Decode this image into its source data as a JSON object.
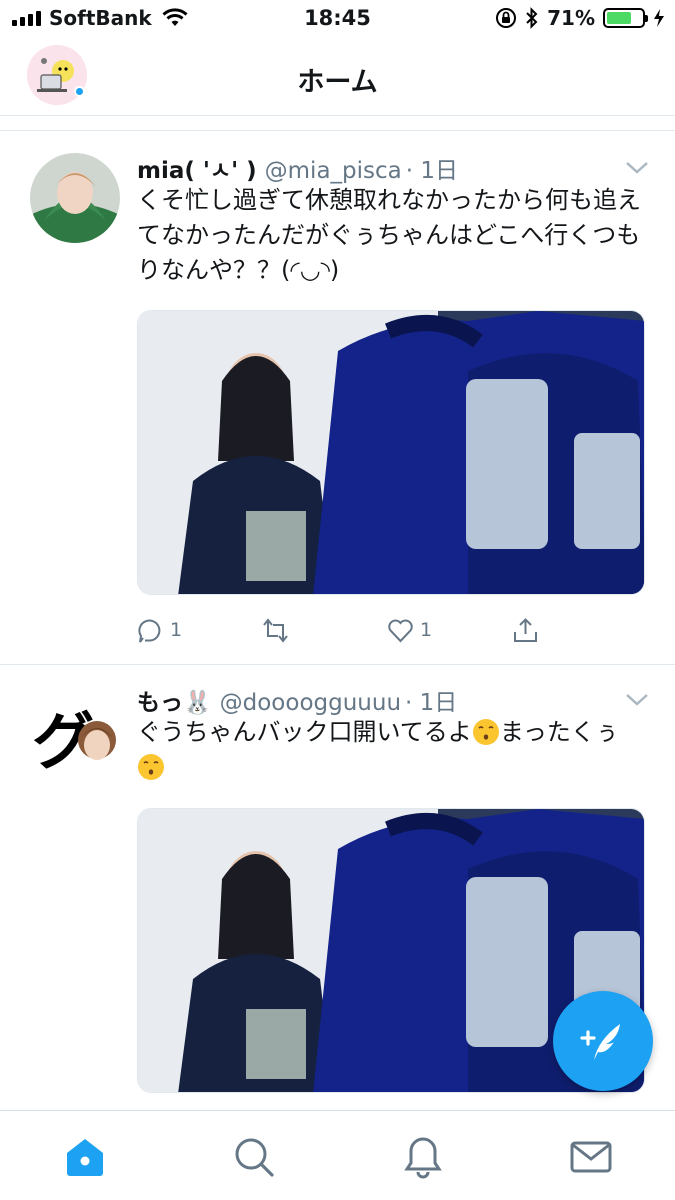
{
  "status_bar": {
    "carrier": "SoftBank",
    "time": "18:45",
    "battery_percent": "71%",
    "battery_level": 0.71
  },
  "header": {
    "title": "ホーム"
  },
  "tweets": [
    {
      "name": "mia( 'ㅅ' )",
      "handle": "@mia_pisca",
      "time": "· 1日",
      "text": "くそ忙し過ぎて休憩取れなかったから何も追えてなかったんだがぐぅちゃんはどこへ行くつもりなんや？？(◜◡◝)",
      "replies": "1",
      "retweets": "",
      "likes": "1"
    },
    {
      "name": "もっ🐰",
      "handle": "@doooogguuuu",
      "time": "· 1日",
      "text_part1": "ぐうちゃんバック口開いてるよ",
      "text_part2": "まったくぅ",
      "avatar_text": "グ"
    }
  ],
  "colors": {
    "accent": "#1da1f2",
    "secondary_text": "#657786",
    "battery": "#4cd964"
  },
  "icons": {
    "tabs": [
      "home-icon",
      "search-icon",
      "bell-icon",
      "mail-icon"
    ],
    "fab": "compose-tweet-icon"
  }
}
